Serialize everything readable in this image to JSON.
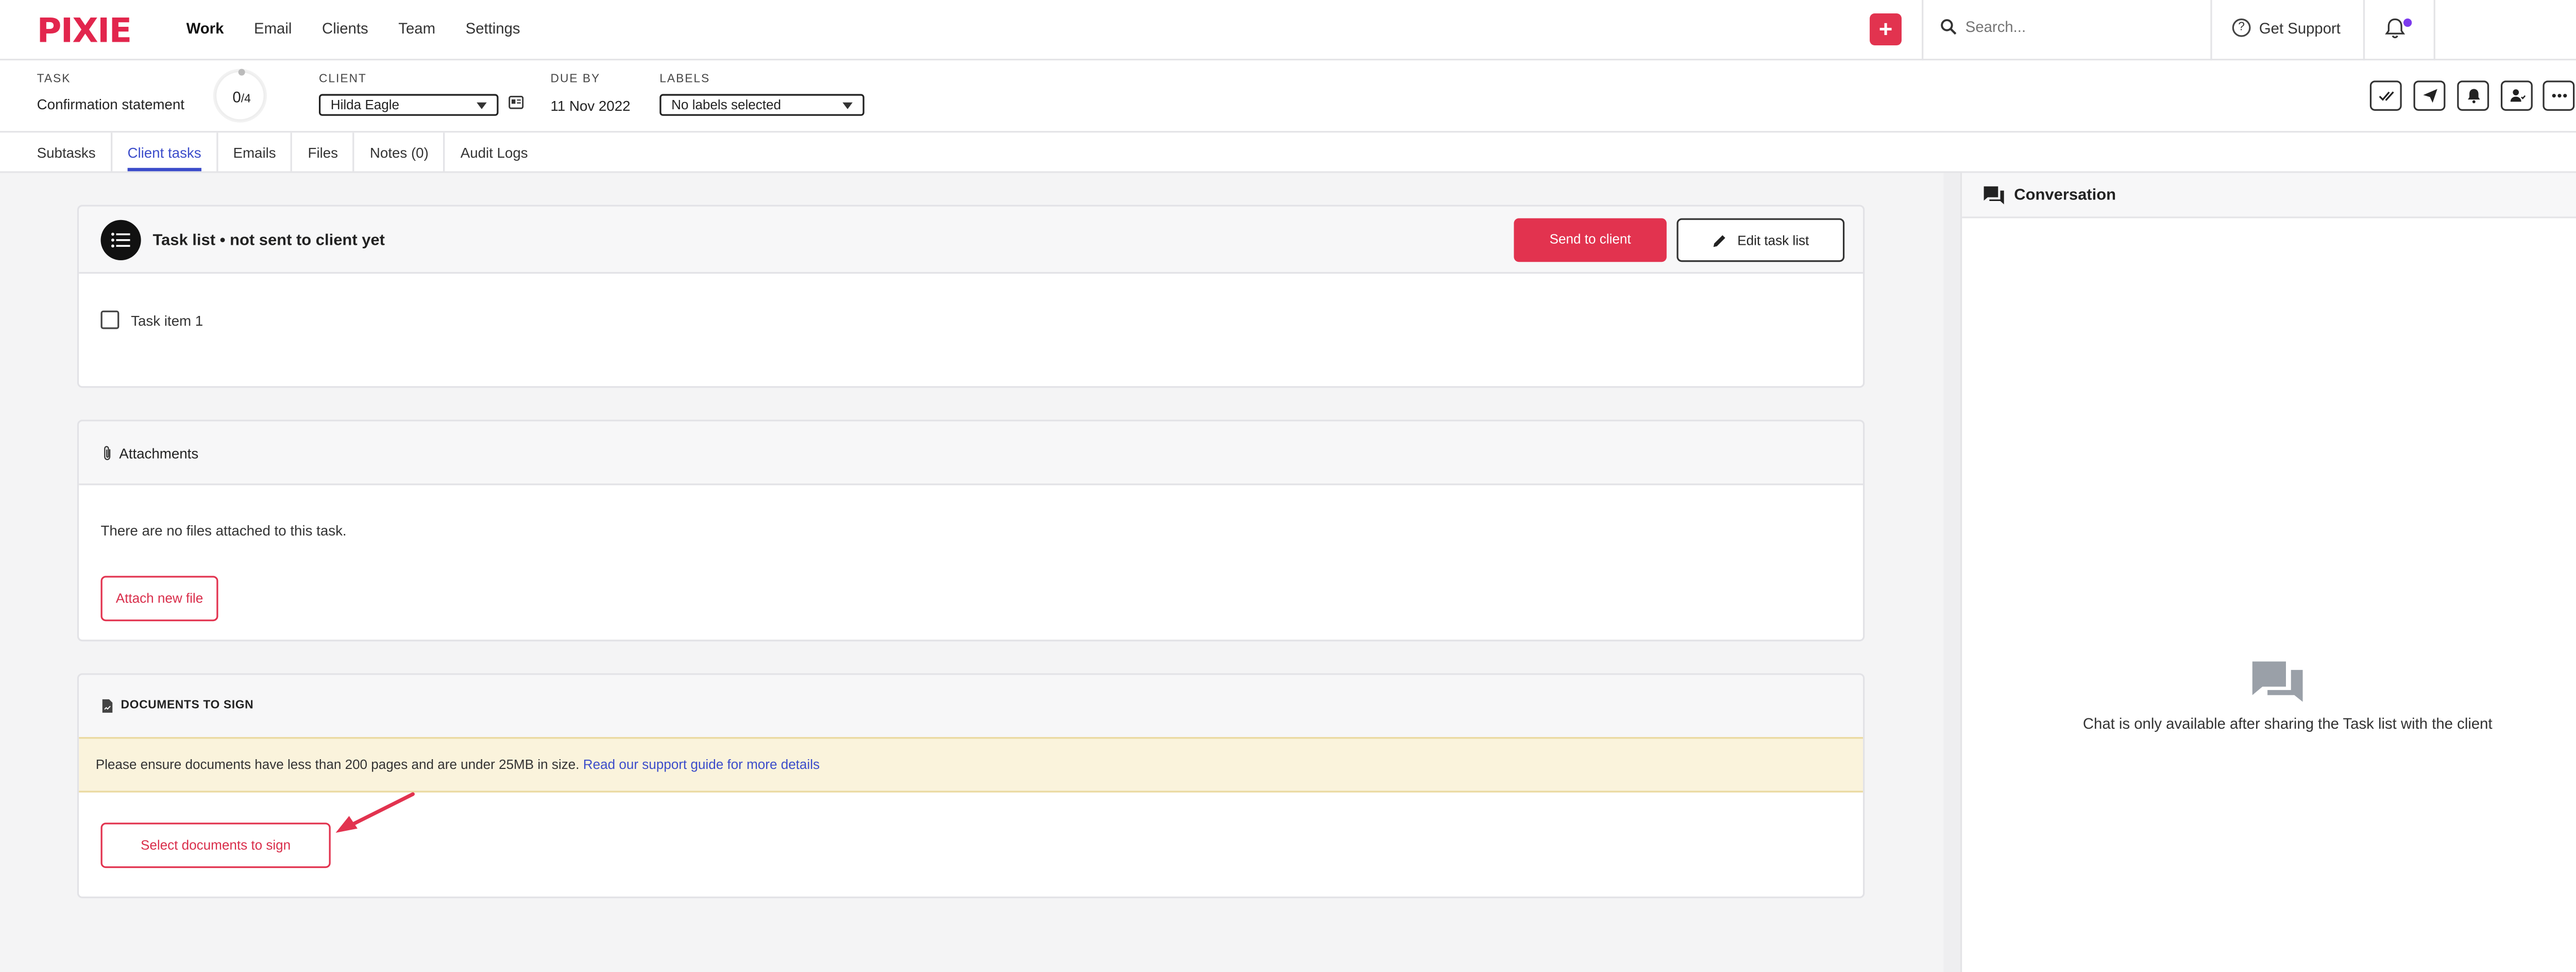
{
  "app": {
    "logo": "PIXIE"
  },
  "nav": {
    "items": [
      "Work",
      "Email",
      "Clients",
      "Team",
      "Settings"
    ],
    "active": "Work",
    "search_placeholder": "Search...",
    "support_label": "Get Support"
  },
  "task": {
    "task_label": "TASK",
    "task_name": "Confirmation statement",
    "progress_done": "0",
    "progress_total": "/4",
    "client_label": "CLIENT",
    "client_value": "Hilda Eagle",
    "due_label": "DUE BY",
    "due_value": "11 Nov 2022",
    "labels_label": "LABELS",
    "labels_value": "No labels selected"
  },
  "tabs": [
    "Subtasks",
    "Client tasks",
    "Emails",
    "Files",
    "Notes (0)",
    "Audit Logs"
  ],
  "active_tab": "Client tasks",
  "task_list": {
    "title": "Task list • not sent to client yet",
    "send_button": "Send to client",
    "edit_button": "Edit task list",
    "items": [
      {
        "label": "Task item 1",
        "checked": false
      }
    ]
  },
  "attachments": {
    "title": "Attachments",
    "empty_text": "There are no files attached to this task.",
    "attach_button": "Attach new file"
  },
  "documents": {
    "title": "DOCUMENTS TO SIGN",
    "notice_text": "Please ensure documents have less than 200 pages and are under 25MB in size.",
    "notice_link": "Read our support guide for more details",
    "select_button": "Select documents to sign"
  },
  "conversation": {
    "title": "Conversation",
    "empty_text": "Chat is only available after sharing the Task list with the client"
  },
  "colors": {
    "brand_red": "#e2264d",
    "button_red": "#e2334f",
    "link_blue": "#3b4cca",
    "notice_bg": "#faf3dc",
    "notification_dot": "#7c3aed"
  },
  "icons": [
    "search-icon",
    "help-icon",
    "bell-icon",
    "chevron-down-icon",
    "id-card-icon",
    "double-check-icon",
    "send-icon",
    "bell-icon",
    "assign-user-icon",
    "more-icon",
    "list-icon",
    "pencil-icon",
    "paperclip-icon",
    "document-sign-icon",
    "chat-icon",
    "arrow-icon"
  ]
}
